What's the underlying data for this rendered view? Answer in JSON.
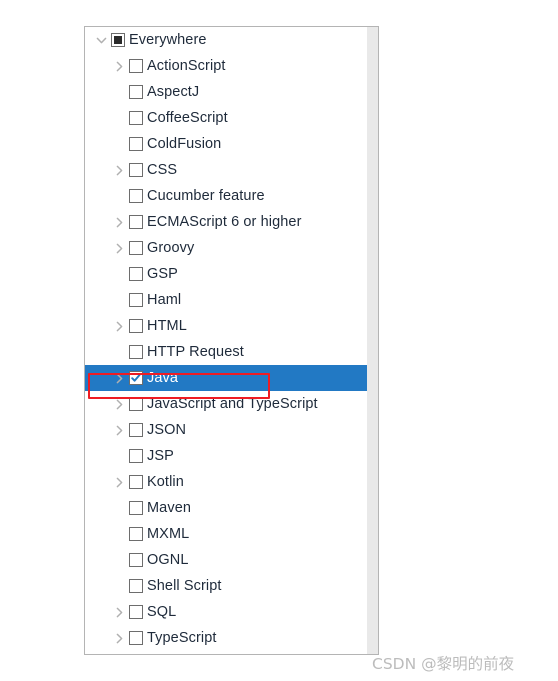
{
  "panel": {
    "name": "file-type-tree",
    "scrollbar": {
      "name": "vertical-scrollbar",
      "position": "right"
    }
  },
  "colors": {
    "selection_blue": "#2279c4",
    "annotation_red": "#ee1c23",
    "text": "#1e2a3a",
    "selected_text": "#ffffff",
    "panel_border": "#b4b4b4",
    "scrollbar_track": "#e9e9e9",
    "checkbox_border": "#6d6d6d",
    "twisty_gray": "#b0b0b0",
    "watermark": "#bcbcbc"
  },
  "tree": {
    "items": [
      {
        "label": "Everywhere",
        "indent": 0,
        "twisty": "chevron-down-icon",
        "checkbox": "partial",
        "selected": false
      },
      {
        "label": "ActionScript",
        "indent": 1,
        "twisty": "chevron-right-icon",
        "checkbox": "unchecked",
        "selected": false
      },
      {
        "label": "AspectJ",
        "indent": 1,
        "twisty": "none",
        "checkbox": "unchecked",
        "selected": false
      },
      {
        "label": "CoffeeScript",
        "indent": 1,
        "twisty": "none",
        "checkbox": "unchecked",
        "selected": false
      },
      {
        "label": "ColdFusion",
        "indent": 1,
        "twisty": "none",
        "checkbox": "unchecked",
        "selected": false
      },
      {
        "label": "CSS",
        "indent": 1,
        "twisty": "chevron-right-icon",
        "checkbox": "unchecked",
        "selected": false
      },
      {
        "label": "Cucumber feature",
        "indent": 1,
        "twisty": "none",
        "checkbox": "unchecked",
        "selected": false
      },
      {
        "label": "ECMAScript 6 or higher",
        "indent": 1,
        "twisty": "chevron-right-icon",
        "checkbox": "unchecked",
        "selected": false
      },
      {
        "label": "Groovy",
        "indent": 1,
        "twisty": "chevron-right-icon",
        "checkbox": "unchecked",
        "selected": false
      },
      {
        "label": "GSP",
        "indent": 1,
        "twisty": "none",
        "checkbox": "unchecked",
        "selected": false
      },
      {
        "label": "Haml",
        "indent": 1,
        "twisty": "none",
        "checkbox": "unchecked",
        "selected": false
      },
      {
        "label": "HTML",
        "indent": 1,
        "twisty": "chevron-right-icon",
        "checkbox": "unchecked",
        "selected": false
      },
      {
        "label": "HTTP Request",
        "indent": 1,
        "twisty": "none",
        "checkbox": "unchecked",
        "selected": false
      },
      {
        "label": "Java",
        "indent": 1,
        "twisty": "chevron-right-icon",
        "checkbox": "checked",
        "selected": true
      },
      {
        "label": "JavaScript and TypeScript",
        "indent": 1,
        "twisty": "chevron-right-icon",
        "checkbox": "unchecked",
        "selected": false
      },
      {
        "label": "JSON",
        "indent": 1,
        "twisty": "chevron-right-icon",
        "checkbox": "unchecked",
        "selected": false
      },
      {
        "label": "JSP",
        "indent": 1,
        "twisty": "none",
        "checkbox": "unchecked",
        "selected": false
      },
      {
        "label": "Kotlin",
        "indent": 1,
        "twisty": "chevron-right-icon",
        "checkbox": "unchecked",
        "selected": false
      },
      {
        "label": "Maven",
        "indent": 1,
        "twisty": "none",
        "checkbox": "unchecked",
        "selected": false
      },
      {
        "label": "MXML",
        "indent": 1,
        "twisty": "none",
        "checkbox": "unchecked",
        "selected": false
      },
      {
        "label": "OGNL",
        "indent": 1,
        "twisty": "none",
        "checkbox": "unchecked",
        "selected": false
      },
      {
        "label": "Shell Script",
        "indent": 1,
        "twisty": "none",
        "checkbox": "unchecked",
        "selected": false
      },
      {
        "label": "SQL",
        "indent": 1,
        "twisty": "chevron-right-icon",
        "checkbox": "unchecked",
        "selected": false
      },
      {
        "label": "TypeScript",
        "indent": 1,
        "twisty": "chevron-right-icon",
        "checkbox": "unchecked",
        "selected": false
      }
    ]
  },
  "annotation": {
    "shape": "rectangle",
    "targets": "Java",
    "color": "#ee1c23"
  },
  "watermark": {
    "text": "CSDN @黎明的前夜"
  }
}
